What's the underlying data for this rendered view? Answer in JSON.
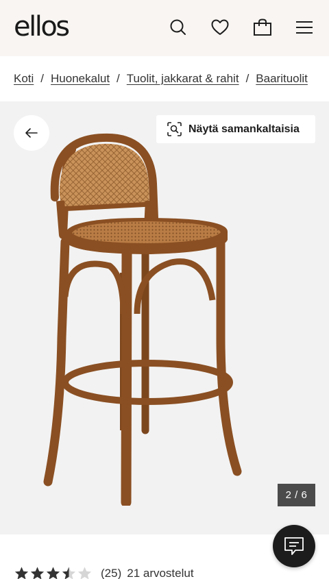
{
  "header": {
    "logo": "ellos",
    "icons": [
      "search-icon",
      "heart-icon",
      "bag-icon",
      "menu-icon"
    ]
  },
  "breadcrumb": {
    "items": [
      "Koti",
      "Huonekalut",
      "Tuolit, jakkarat & rahit",
      "Baarituolit"
    ],
    "separator": "/"
  },
  "gallery": {
    "similar_label": "Näytä samankaltaisia",
    "counter": "2 / 6",
    "background": "#f2f2f2"
  },
  "rating": {
    "stars": 3.5,
    "max": 5,
    "count": "(25)",
    "reviews": "21 arvostelut"
  },
  "colors": {
    "header_bg": "#f8f5f2",
    "wood": "#8a4f22",
    "chat_bg": "#1c1c1c"
  }
}
